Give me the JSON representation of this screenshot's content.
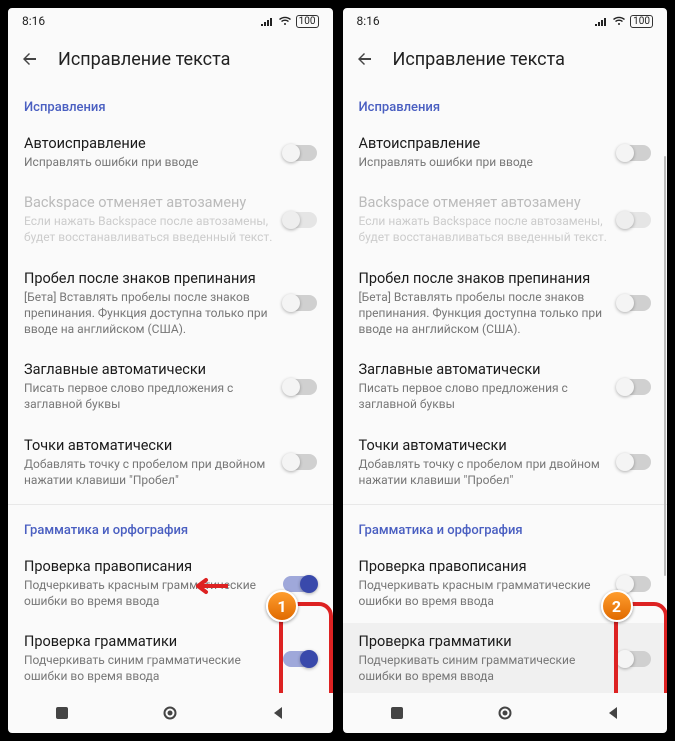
{
  "status": {
    "time": "8:16",
    "battery": "100"
  },
  "appbar": {
    "title": "Исправление текста"
  },
  "sections": {
    "corrections": "Исправления",
    "grammar": "Грамматика и орфография"
  },
  "items": {
    "auto": {
      "title": "Автоисправление",
      "sub": "Исправлять ошибки при вводе"
    },
    "backspace": {
      "title": "Backspace отменяет автозамену",
      "sub": "Если нажать Backspace после автозамены, будет восстанавливаться введенный текст."
    },
    "space": {
      "title": "Пробел после знаков препинания",
      "sub": "[Бета] Вставлять пробелы после знаков препинания. Функция доступна только при вводе на английском (США)."
    },
    "caps": {
      "title": "Заглавные автоматически",
      "sub": "Писать первое слово предложения с заглавной буквы"
    },
    "dots": {
      "title": "Точки автоматически",
      "sub": "Добавлять точку с пробелом при двойном нажатии клавиши \"Пробел\""
    },
    "spell": {
      "title": "Проверка правописания",
      "sub": "Подчеркивать красным грамматические ошибки во время ввода"
    },
    "gram": {
      "title": "Проверка грамматики",
      "sub": "Подчеркивать синим грамматические ошибки во время ввода"
    }
  },
  "badges": {
    "one": "1",
    "two": "2"
  }
}
